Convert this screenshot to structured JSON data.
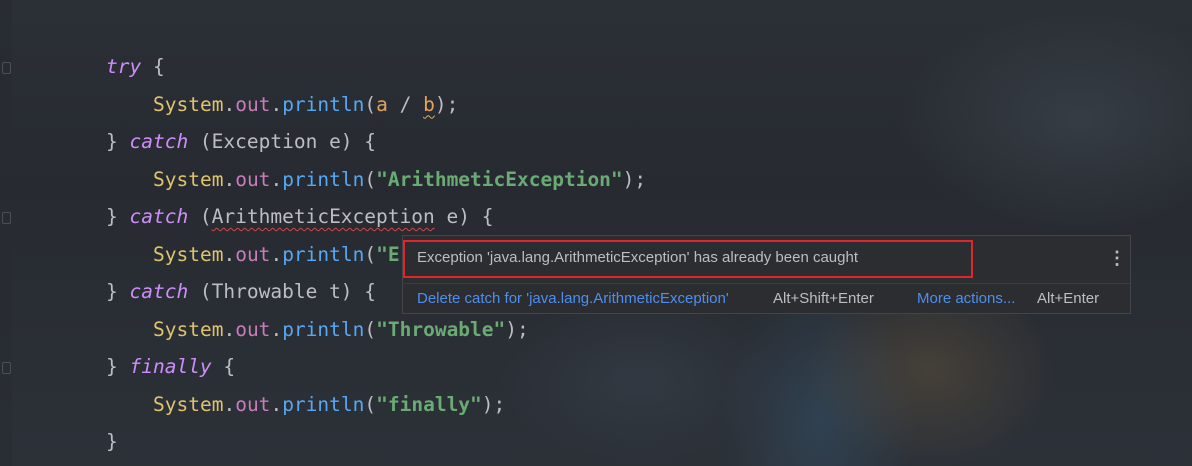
{
  "editor": {
    "lines": [
      {
        "indent": 0,
        "tokens": [
          {
            "t": "try",
            "c": "kw"
          },
          {
            "t": " {",
            "c": "plain"
          }
        ]
      },
      {
        "indent": 1,
        "tokens": [
          {
            "t": "System",
            "c": "cls"
          },
          {
            "t": ".",
            "c": "plain"
          },
          {
            "t": "out",
            "c": "fld"
          },
          {
            "t": ".",
            "c": "plain"
          },
          {
            "t": "println",
            "c": "mth"
          },
          {
            "t": "(",
            "c": "plain"
          },
          {
            "t": "a",
            "c": "par"
          },
          {
            "t": " / ",
            "c": "plain"
          },
          {
            "t": "b",
            "c": "par squiggle-warn"
          },
          {
            "t": ");",
            "c": "plain"
          }
        ]
      },
      {
        "indent": 0,
        "tokens": [
          {
            "t": "} ",
            "c": "plain"
          },
          {
            "t": "catch",
            "c": "kw"
          },
          {
            "t": " (Exception e) {",
            "c": "plain"
          }
        ]
      },
      {
        "indent": 1,
        "tokens": [
          {
            "t": "System",
            "c": "cls"
          },
          {
            "t": ".",
            "c": "plain"
          },
          {
            "t": "out",
            "c": "fld"
          },
          {
            "t": ".",
            "c": "plain"
          },
          {
            "t": "println",
            "c": "mth"
          },
          {
            "t": "(",
            "c": "plain"
          },
          {
            "t": "\"ArithmeticException\"",
            "c": "str"
          },
          {
            "t": ");",
            "c": "plain"
          }
        ]
      },
      {
        "indent": 0,
        "tokens": [
          {
            "t": "} ",
            "c": "plain"
          },
          {
            "t": "catch",
            "c": "kw"
          },
          {
            "t": " (",
            "c": "plain"
          },
          {
            "t": "ArithmeticException",
            "c": "plain squiggle-err"
          },
          {
            "t": " e) {",
            "c": "plain"
          }
        ]
      },
      {
        "indent": 1,
        "tokens": [
          {
            "t": "System",
            "c": "cls"
          },
          {
            "t": ".",
            "c": "plain"
          },
          {
            "t": "out",
            "c": "fld"
          },
          {
            "t": ".",
            "c": "plain"
          },
          {
            "t": "println",
            "c": "mth"
          },
          {
            "t": "(",
            "c": "plain"
          },
          {
            "t": "\"E",
            "c": "str"
          }
        ]
      },
      {
        "indent": 0,
        "tokens": [
          {
            "t": "} ",
            "c": "plain"
          },
          {
            "t": "catch",
            "c": "kw"
          },
          {
            "t": " (Throwable t) {",
            "c": "plain"
          }
        ]
      },
      {
        "indent": 1,
        "tokens": [
          {
            "t": "System",
            "c": "cls"
          },
          {
            "t": ".",
            "c": "plain"
          },
          {
            "t": "out",
            "c": "fld"
          },
          {
            "t": ".",
            "c": "plain"
          },
          {
            "t": "println",
            "c": "mth"
          },
          {
            "t": "(",
            "c": "plain"
          },
          {
            "t": "\"Throwable\"",
            "c": "str"
          },
          {
            "t": ");",
            "c": "plain"
          }
        ]
      },
      {
        "indent": 0,
        "tokens": [
          {
            "t": "} ",
            "c": "plain"
          },
          {
            "t": "finally",
            "c": "kw"
          },
          {
            "t": " {",
            "c": "plain"
          }
        ]
      },
      {
        "indent": 1,
        "tokens": [
          {
            "t": "System",
            "c": "cls"
          },
          {
            "t": ".",
            "c": "plain"
          },
          {
            "t": "out",
            "c": "fld"
          },
          {
            "t": ".",
            "c": "plain"
          },
          {
            "t": "println",
            "c": "mth"
          },
          {
            "t": "(",
            "c": "plain"
          },
          {
            "t": "\"finally\"",
            "c": "str"
          },
          {
            "t": ");",
            "c": "plain"
          }
        ]
      },
      {
        "indent": 0,
        "tokens": [
          {
            "t": "}",
            "c": "plain"
          }
        ]
      }
    ]
  },
  "popup": {
    "message": "Exception 'java.lang.ArithmeticException' has already been caught",
    "more_icon": "⋮",
    "primary_action": "Delete catch for 'java.lang.ArithmeticException'",
    "primary_shortcut": "Alt+Shift+Enter",
    "more_actions": "More actions...",
    "more_shortcut": "Alt+Enter"
  },
  "colors": {
    "keyword": "#cf8dfb",
    "class": "#e0c46c",
    "field": "#c77dbb",
    "method": "#56a8f5",
    "param": "#e6a25c",
    "string": "#6aab73",
    "link": "#4d8fef",
    "highlight_border": "#e0262a"
  }
}
